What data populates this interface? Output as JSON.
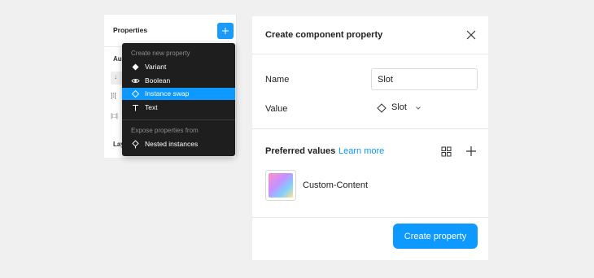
{
  "props_panel": {
    "title": "Properties",
    "section_auto": "Au",
    "section_layout": "Lay",
    "icon_arrow_down": "↓",
    "icon_spacing": "]⁞[",
    "icon_padding": "|□|"
  },
  "menu": {
    "create_heading": "Create new property",
    "items": [
      {
        "label": "Variant",
        "icon": "diamond-filled-icon"
      },
      {
        "label": "Boolean",
        "icon": "eye-icon"
      },
      {
        "label": "Instance swap",
        "icon": "diamond-outline-icon",
        "active": true
      },
      {
        "label": "Text",
        "icon": "text-icon"
      }
    ],
    "expose_heading": "Expose properties from",
    "expose_items": [
      {
        "label": "Nested instances",
        "icon": "nested-instance-icon"
      }
    ]
  },
  "dialog": {
    "title": "Create component property",
    "name_label": "Name",
    "name_value": "Slot",
    "value_label": "Value",
    "value_selected": "Slot",
    "preferred_title": "Preferred values",
    "learn_more": "Learn more",
    "preferred_items": [
      {
        "label": "Custom-Content"
      }
    ],
    "create_button": "Create property"
  },
  "colors": {
    "accent": "#0d99ff",
    "menu_bg": "#1e1e1e",
    "page_bg": "#f0f0f0"
  }
}
